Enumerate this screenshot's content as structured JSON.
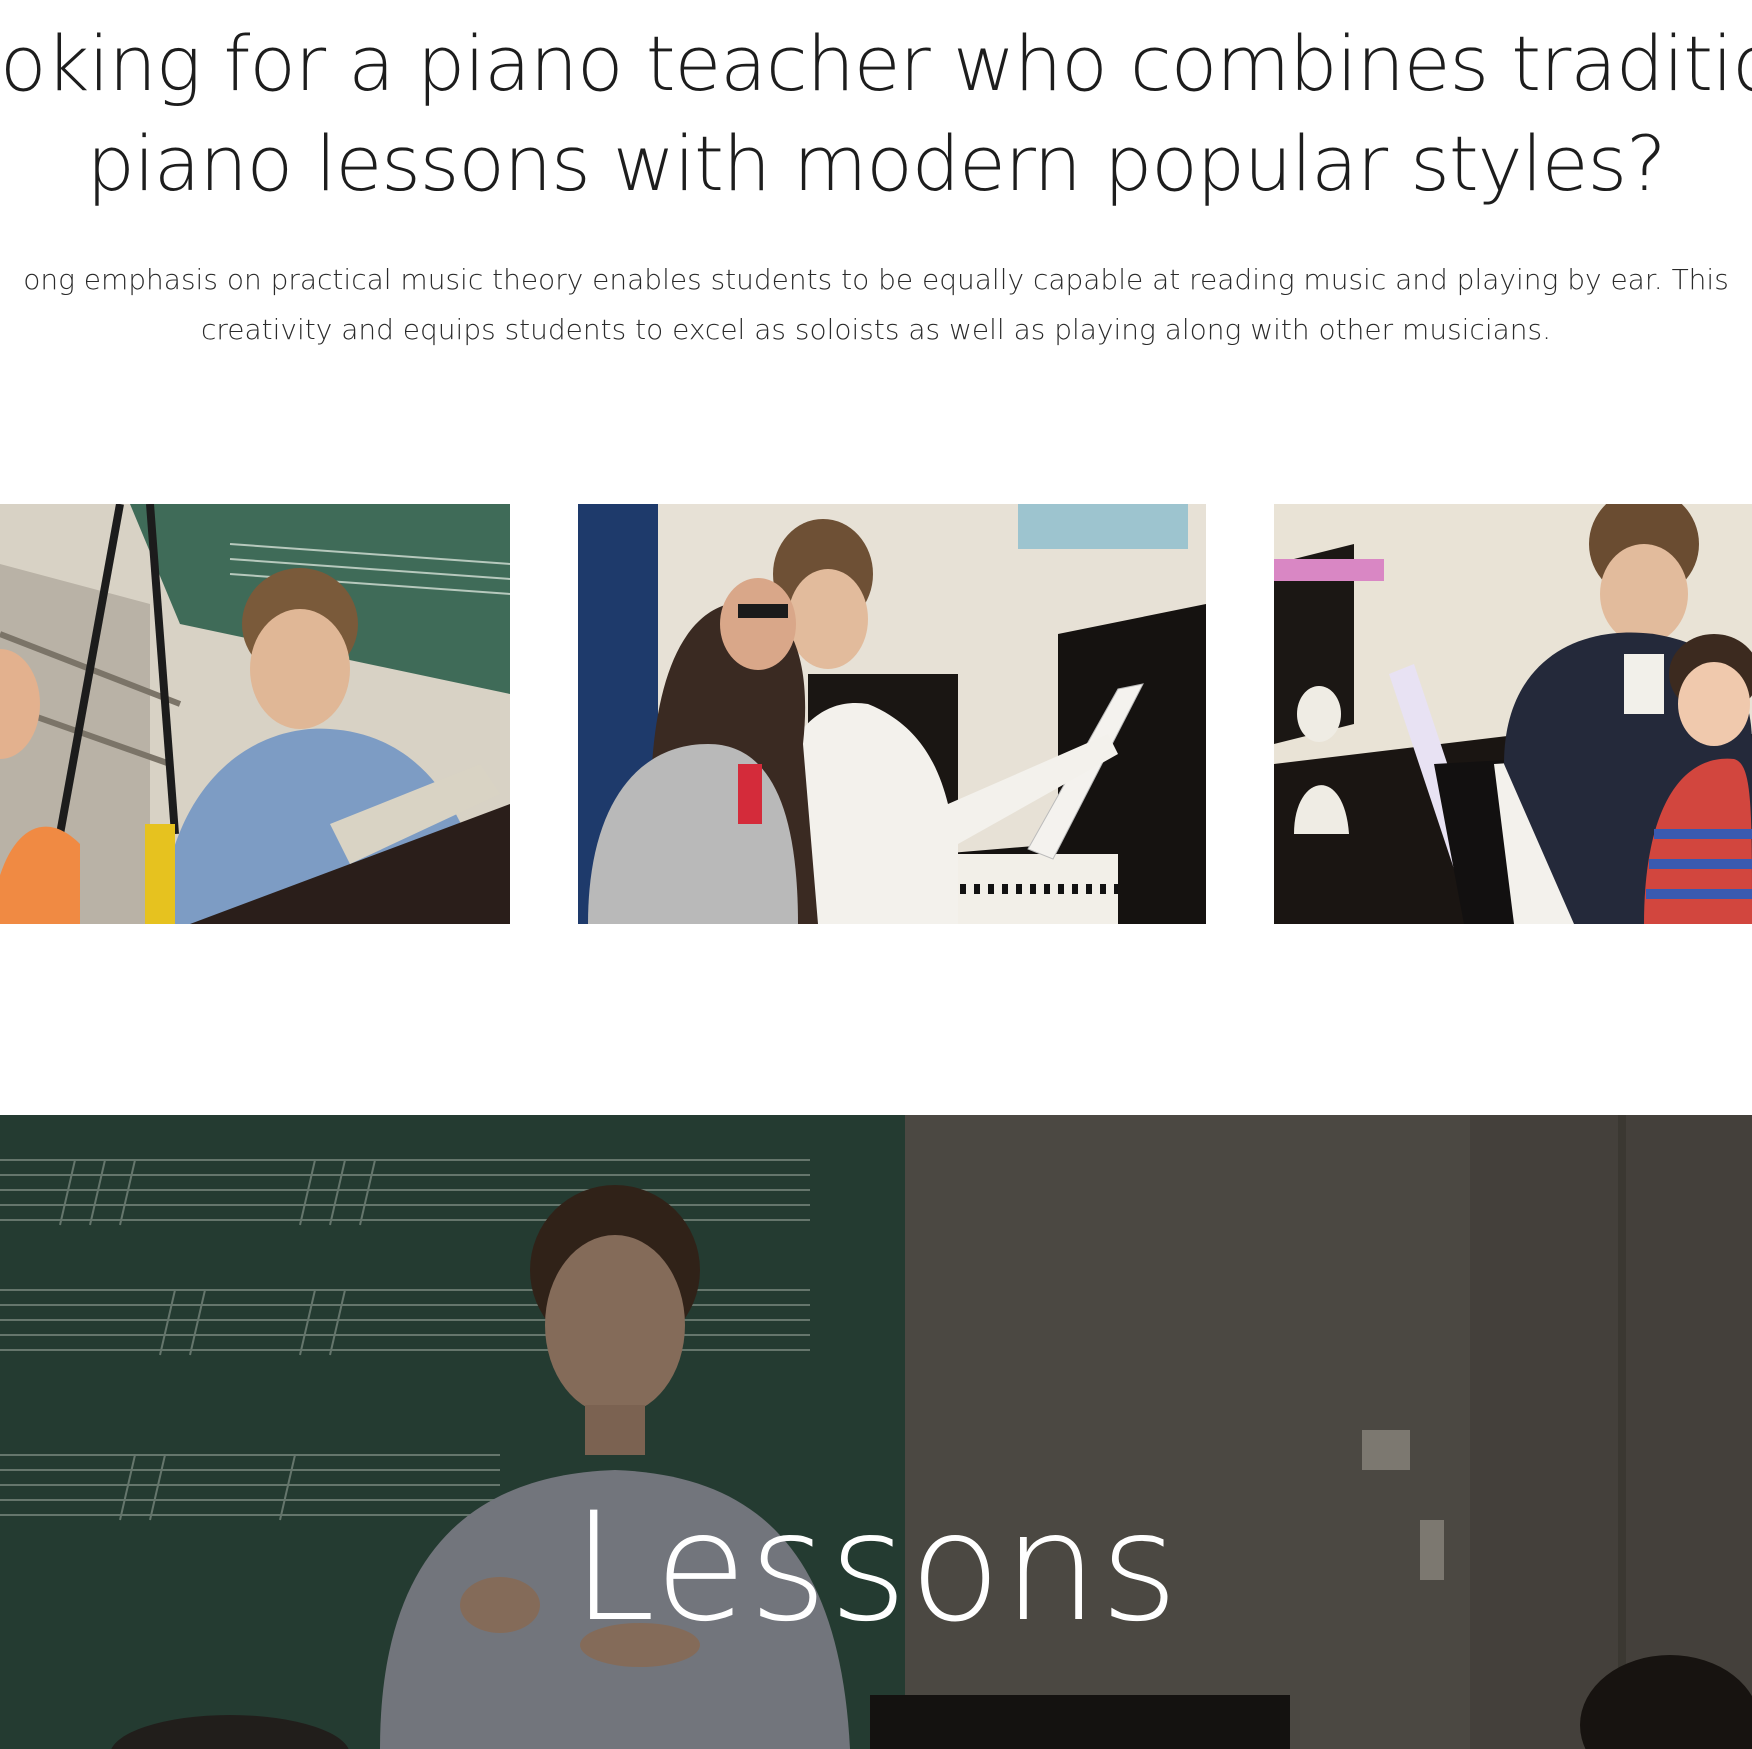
{
  "intro": {
    "heading_line1": "oking for a piano teacher who combines traditional class",
    "heading_line2": "piano lessons with modern popular styles?",
    "text_line1": "ong emphasis on practical music theory enables students to be equally capable at reading music and playing by ear. This",
    "text_line2": "creativity and equips students to excel as soloists as well as playing along with other musicians."
  },
  "gallery": {
    "photos": [
      {
        "icon": "teacher-with-child-at-piano-photo"
      },
      {
        "icon": "teacher-pointing-at-sheet-music-photo"
      },
      {
        "icon": "teacher-guiding-boy-at-piano-photo"
      }
    ]
  },
  "banner": {
    "title": "Lessons",
    "icon": "teacher-at-chalkboard-photo"
  },
  "colors": {
    "chalkboard": "#2e4a3e",
    "wall": "#e9e3d8",
    "banner_overlay": "#3b3a34",
    "heading": "#1d1d1d"
  }
}
